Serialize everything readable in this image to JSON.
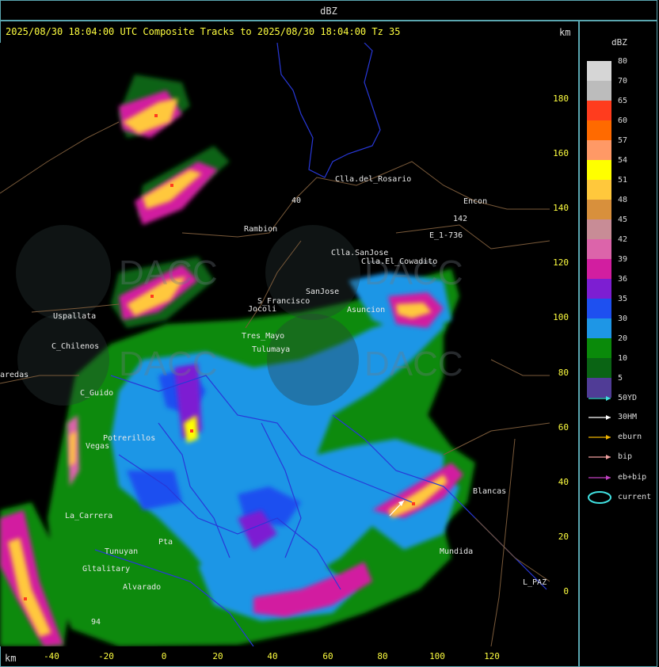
{
  "header": {
    "product": "dBZ"
  },
  "map": {
    "title": "2025/08/30 18:04:00 UTC Composite Tracks to 2025/08/30 18:04:00 Tz 35",
    "unit_top": "km",
    "unit_bottom": "km",
    "y_ticks": [
      "180",
      "160",
      "140",
      "120",
      "100",
      "80",
      "60",
      "40",
      "20",
      "0"
    ],
    "x_ticks": [
      "-40",
      "-20",
      "0",
      "20",
      "40",
      "60",
      "80",
      "100",
      "120"
    ],
    "watermark_text": "DACC",
    "places": [
      {
        "name": "Clla.del_Rosario"
      },
      {
        "name": "Encon"
      },
      {
        "name": "142"
      },
      {
        "name": "E_1-736"
      },
      {
        "name": "Rambion"
      },
      {
        "name": "40"
      },
      {
        "name": "Clla.SanJose"
      },
      {
        "name": "Clla.El_Cowadito"
      },
      {
        "name": "S_Francisco"
      },
      {
        "name": "SanJose"
      },
      {
        "name": "Jocoli"
      },
      {
        "name": "Asuncion"
      },
      {
        "name": "Uspallata"
      },
      {
        "name": "Tres_Mayo"
      },
      {
        "name": "Tulumaya"
      },
      {
        "name": "C_Chilenos"
      },
      {
        "name": "aredas"
      },
      {
        "name": "C_Guido"
      },
      {
        "name": "Potrerillos"
      },
      {
        "name": "Vegas"
      },
      {
        "name": "La_Carrera"
      },
      {
        "name": "Gltalitary"
      },
      {
        "name": "Tunuyan"
      },
      {
        "name": "Pta"
      },
      {
        "name": "Alvarado"
      },
      {
        "name": "L_PAZ"
      },
      {
        "name": "Blancas"
      },
      {
        "name": "Mundida"
      },
      {
        "name": "94"
      }
    ]
  },
  "legend": {
    "title": "dBZ",
    "scale": [
      {
        "label": "80",
        "color": "#d6d6d6"
      },
      {
        "label": "70",
        "color": "#bcbcbc"
      },
      {
        "label": "65",
        "color": "#ff3c1e"
      },
      {
        "label": "60",
        "color": "#ff6a00"
      },
      {
        "label": "57",
        "color": "#ff9966"
      },
      {
        "label": "54",
        "color": "#ffff00"
      },
      {
        "label": "51",
        "color": "#ffc83c"
      },
      {
        "label": "48",
        "color": "#d8903c"
      },
      {
        "label": "45",
        "color": "#c88c96"
      },
      {
        "label": "42",
        "color": "#dc64aa"
      },
      {
        "label": "39",
        "color": "#d21ea0"
      },
      {
        "label": "36",
        "color": "#7d1ed2"
      },
      {
        "label": "35",
        "color": "#1e50f0"
      },
      {
        "label": "30",
        "color": "#1e96e6"
      },
      {
        "label": "20",
        "color": "#0a8a0a"
      },
      {
        "label": "10",
        "color": "#0a6414"
      },
      {
        "label": "5",
        "color": "#503c96"
      }
    ],
    "tracks": [
      {
        "label": "50YD",
        "color": "#40e0e0"
      },
      {
        "label": "30HM",
        "color": "#ffffff"
      },
      {
        "label": "eburn",
        "color": "#f0b400"
      },
      {
        "label": "bip",
        "color": "#f0a0a0"
      },
      {
        "label": "eb+bip",
        "color": "#c040c0"
      },
      {
        "label": "current",
        "color": "#40e0e0"
      }
    ]
  }
}
